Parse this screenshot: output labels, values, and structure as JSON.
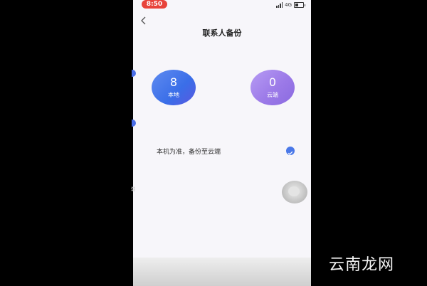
{
  "status_bar": {
    "time": "8:50",
    "network": "4G"
  },
  "header": {
    "title": "联系人备份",
    "back_icon": "chevron-left-icon"
  },
  "stats": {
    "local": {
      "count": "8",
      "label": "本地"
    },
    "cloud": {
      "count": "0",
      "label": "云端"
    }
  },
  "option": {
    "label": "本机为准，备份至云端",
    "checked": true
  },
  "side_char": "键",
  "watermark": "云南龙网",
  "colors": {
    "accent": "#4a78e8",
    "status_pill": "#e8433b",
    "cloud_circle": "#a88cf0",
    "local_circle": "#4f7ef0"
  }
}
